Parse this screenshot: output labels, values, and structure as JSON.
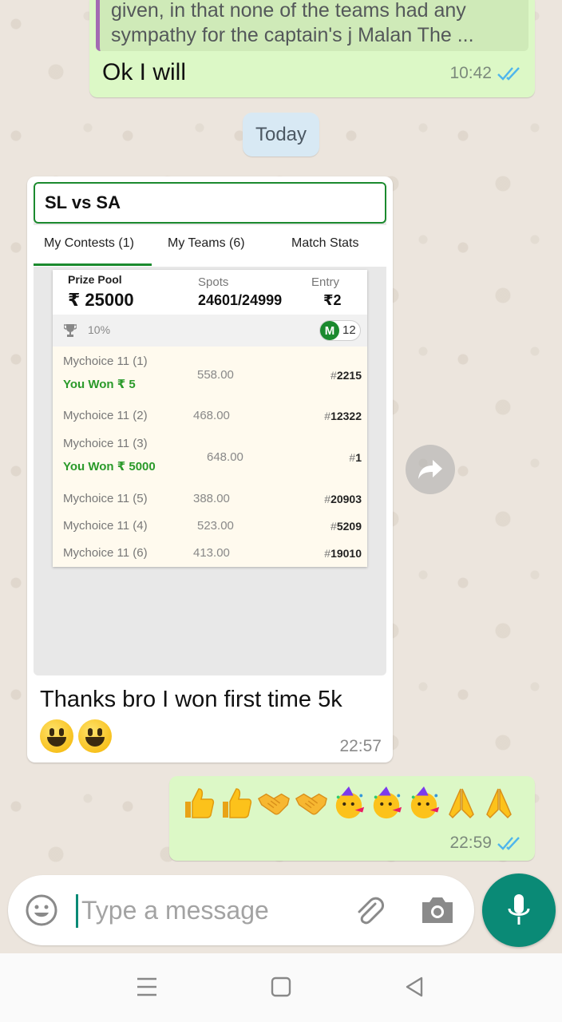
{
  "messages": {
    "top_out": {
      "quote_line1": "given, in that none of the teams had any",
      "quote_line2": "sympathy for the captain's j Malan The ...",
      "text": "Ok I will",
      "time": "10:42"
    },
    "date_chip": "Today",
    "incoming": {
      "screenshot": {
        "match_title": "SL vs SA",
        "tabs": [
          "My Contests (1)",
          "My Teams (6)",
          "Match Stats"
        ],
        "prize_pool_label": "Prize Pool",
        "prize_pool_value": "₹ 25000",
        "spots_label": "Spots",
        "spots_value": "24601/24999",
        "entry_label": "Entry",
        "entry_value": "₹2",
        "winners_pct": "10%",
        "badge_letter": "M",
        "badge_count": "12",
        "rows": [
          {
            "team": "Mychoice 11 (1)",
            "won": "You Won ₹ 5",
            "points": "558.00",
            "rank_hash": "#",
            "rank": "2215"
          },
          {
            "team": "Mychoice 11 (2)",
            "won": "",
            "points": "468.00",
            "rank_hash": "#",
            "rank": "12322"
          },
          {
            "team": "Mychoice 11 (3)",
            "won": "You Won ₹ 5000",
            "points": "648.00",
            "rank_hash": "#",
            "rank": "1"
          },
          {
            "team": "Mychoice 11 (5)",
            "won": "",
            "points": "388.00",
            "rank_hash": "#",
            "rank": "20903"
          },
          {
            "team": "Mychoice 11 (4)",
            "won": "",
            "points": "523.00",
            "rank_hash": "#",
            "rank": "5209"
          },
          {
            "team": "Mychoice 11 (6)",
            "won": "",
            "points": "413.00",
            "rank_hash": "#",
            "rank": "19010"
          }
        ]
      },
      "caption": "Thanks bro I won first time 5k",
      "emojis": [
        "grinning-face",
        "grinning-face"
      ],
      "time": "22:57"
    },
    "bottom_out": {
      "emojis": [
        "thumbs-up",
        "thumbs-up",
        "handshake",
        "handshake",
        "partying-face",
        "partying-face",
        "partying-face",
        "folded-hands",
        "folded-hands"
      ],
      "time": "22:59"
    }
  },
  "composer": {
    "placeholder": "Type a message"
  },
  "colors": {
    "outgoing_bubble": "#dcf8c6",
    "accent": "#0a8a76",
    "read_ticks": "#4fb6ec",
    "fantasy_green": "#1b8a2e"
  }
}
